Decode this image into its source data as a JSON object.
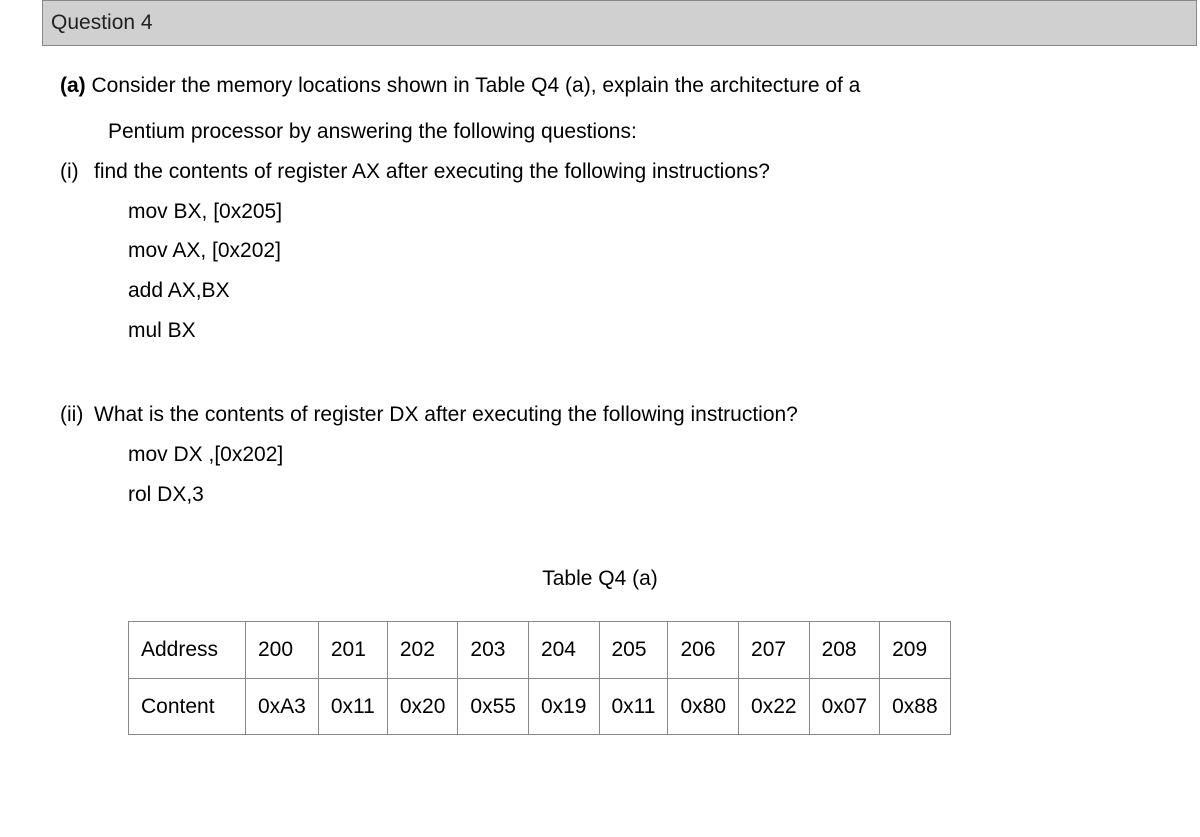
{
  "header": {
    "title": "Question 4"
  },
  "partA": {
    "label": "(a)",
    "text1": "Consider the memory locations shown in Table Q4 (a), explain the architecture of a",
    "text2": "Pentium processor by answering the following questions:"
  },
  "subI": {
    "label": "(i)",
    "text": "find the contents of register AX after executing the following instructions?",
    "code": {
      "l1": "mov BX, [0x205]",
      "l2": "mov AX, [0x202]",
      "l3": "add AX,BX",
      "l4": "mul BX"
    }
  },
  "subII": {
    "label": "(ii)",
    "text": "What is the contents of register DX after executing the following instruction?",
    "code": {
      "l1": "mov DX ,[0x202]",
      "l2": "rol DX,3"
    }
  },
  "table": {
    "caption": "Table Q4 (a)",
    "row1Label": "Address",
    "row2Label": "Content",
    "addresses": [
      "200",
      "201",
      "202",
      "203",
      "204",
      "205",
      "206",
      "207",
      "208",
      "209"
    ],
    "contents": [
      "0xA3",
      "0x11",
      "0x20",
      "0x55",
      "0x19",
      "0x11",
      "0x80",
      "0x22",
      "0x07",
      "0x88"
    ]
  }
}
